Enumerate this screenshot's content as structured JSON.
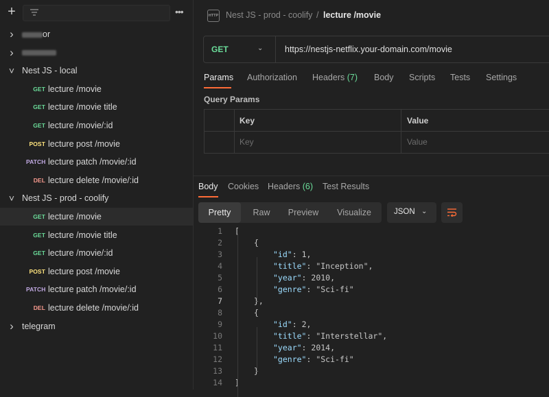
{
  "sidebar": {
    "items": [
      {
        "kind": "folder",
        "label": "or",
        "redacted": true,
        "blur_width": 30,
        "expanded": false
      },
      {
        "kind": "folder",
        "label": "",
        "redacted": true,
        "blur_width": 50,
        "expanded": false
      },
      {
        "kind": "folder",
        "label": "Nest JS - local",
        "expanded": true
      },
      {
        "kind": "request",
        "method": "GET",
        "label": "lecture /movie"
      },
      {
        "kind": "request",
        "method": "GET",
        "label": "lecture /movie title"
      },
      {
        "kind": "request",
        "method": "GET",
        "label": "lecture /movie/:id"
      },
      {
        "kind": "request",
        "method": "POST",
        "label": "lecture post /movie"
      },
      {
        "kind": "request",
        "method": "PATCH",
        "label": "lecture patch /movie/:id"
      },
      {
        "kind": "request",
        "method": "DEL",
        "label": "lecture delete /movie/:id"
      },
      {
        "kind": "folder",
        "label": "Nest JS - prod - coolify",
        "expanded": true
      },
      {
        "kind": "request",
        "method": "GET",
        "label": "lecture /movie",
        "selected": true
      },
      {
        "kind": "request",
        "method": "GET",
        "label": "lecture /movie title"
      },
      {
        "kind": "request",
        "method": "GET",
        "label": "lecture /movie/:id"
      },
      {
        "kind": "request",
        "method": "POST",
        "label": "lecture post /movie"
      },
      {
        "kind": "request",
        "method": "PATCH",
        "label": "lecture patch /movie/:id"
      },
      {
        "kind": "request",
        "method": "DEL",
        "label": "lecture delete /movie/:id"
      },
      {
        "kind": "folder",
        "label": "telegram",
        "expanded": false
      }
    ]
  },
  "header": {
    "icon_text": "HTTP",
    "parent": "Nest JS - prod - coolify",
    "separator": "/",
    "current": "lecture /movie"
  },
  "request": {
    "method": "GET",
    "url": "https://nestjs-netflix.your-domain.com/movie",
    "tabs": [
      "Params",
      "Authorization",
      "Headers",
      "Body",
      "Scripts",
      "Tests",
      "Settings"
    ],
    "headers_count": "(7)",
    "active_tab": "Params"
  },
  "params": {
    "section_label": "Query Params",
    "col_key": "Key",
    "col_value": "Value",
    "ph_key": "Key",
    "ph_value": "Value"
  },
  "response": {
    "tabs": [
      "Body",
      "Cookies",
      "Headers",
      "Test Results"
    ],
    "headers_count": "(6)",
    "views": [
      "Pretty",
      "Raw",
      "Preview",
      "Visualize"
    ],
    "active_view": "Pretty",
    "language": "JSON",
    "lines": [
      "[",
      "{",
      "\"id\": 1,",
      "\"title\": \"Inception\",",
      "\"year\": 2010,",
      "\"genre\": \"Sci-fi\"",
      "},",
      "{",
      "\"id\": 2,",
      "\"title\": \"Interstellar\",",
      "\"year\": 2014,",
      "\"genre\": \"Sci-fi\"",
      "}",
      "]"
    ],
    "line_numbers": [
      "1",
      "2",
      "3",
      "4",
      "5",
      "6",
      "7",
      "8",
      "9",
      "10",
      "11",
      "12",
      "13",
      "14"
    ]
  },
  "colors": {
    "get": "#6bdd9a",
    "post": "#ffe47e",
    "patch": "#c0a8e1",
    "del": "#f79a8e",
    "accent": "#ff6c37"
  },
  "icons": [
    "plus-icon",
    "filter-icon",
    "more-icon",
    "chevron-right-icon",
    "chevron-down-icon",
    "http-icon",
    "wrap-lines-icon"
  ]
}
